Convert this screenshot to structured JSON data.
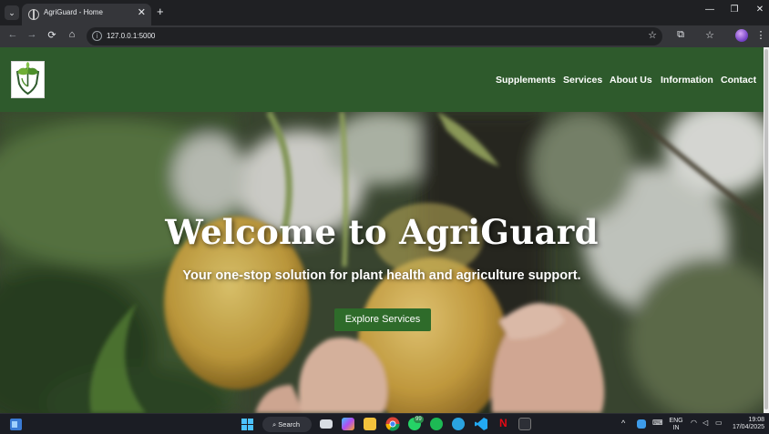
{
  "browser": {
    "tab_title": "AgriGuard - Home",
    "tab_close": "✕",
    "new_tab": "+",
    "url": "127.0.0.1:5000",
    "window_controls": {
      "minimize": "—",
      "restore": "❐",
      "close": "✕"
    }
  },
  "site": {
    "nav": [
      "Supplements",
      "Services",
      "About Us",
      "Information",
      "Contact"
    ],
    "hero": {
      "title": "Welcome to AgriGuard",
      "subtitle": "Your one-stop solution for plant health and agriculture support.",
      "cta": "Explore Services"
    }
  },
  "taskbar": {
    "search_label": "Search",
    "language": "ENG",
    "region": "IN",
    "time": "19:08",
    "date": "17/04/2025",
    "whatsapp_badge": "99"
  },
  "colors": {
    "header_green": "#2e5a2c",
    "button_green": "#2e6b2a"
  }
}
